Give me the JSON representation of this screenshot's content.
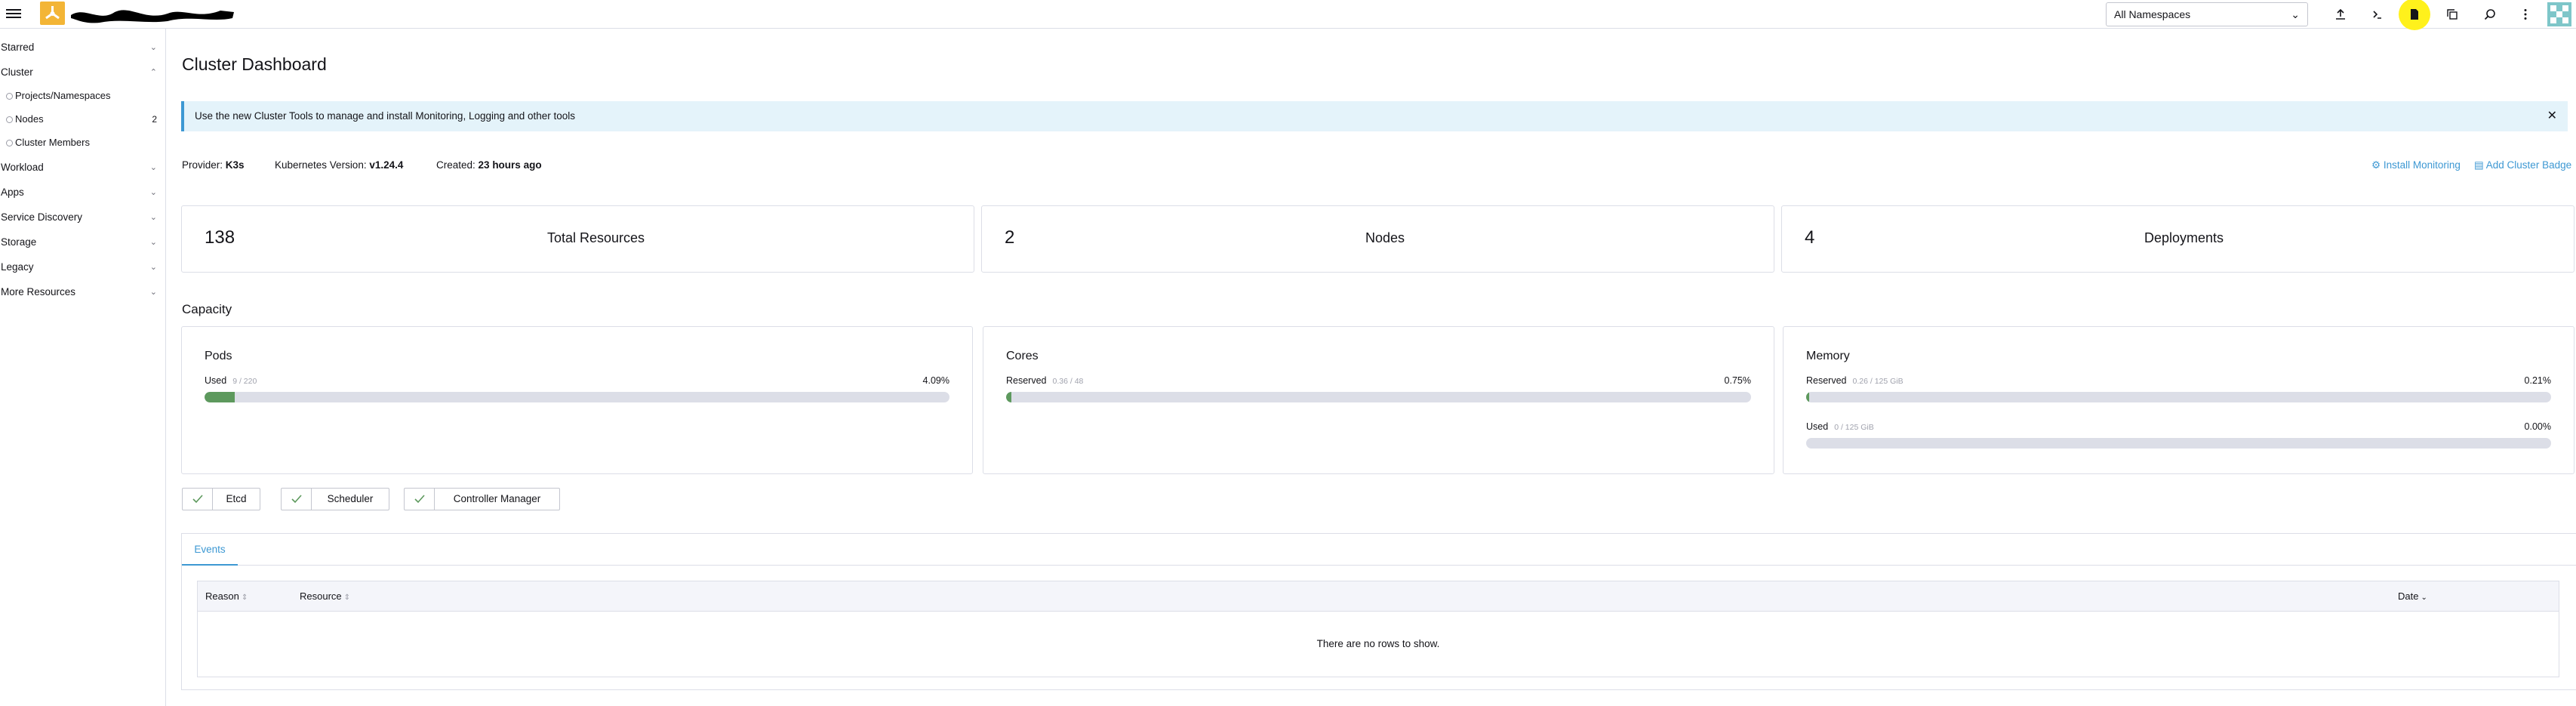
{
  "header": {
    "namespace_select": "All Namespaces",
    "icons": [
      "upload-icon",
      "terminal-icon",
      "file-icon",
      "copy-icon",
      "search-icon",
      "more-vert-icon"
    ]
  },
  "sidebar": {
    "groups": [
      {
        "label": "Starred"
      },
      {
        "label": "Cluster"
      },
      {
        "label": "Workload"
      },
      {
        "label": "Apps"
      },
      {
        "label": "Service Discovery"
      },
      {
        "label": "Storage"
      },
      {
        "label": "Legacy"
      },
      {
        "label": "More Resources"
      }
    ],
    "cluster_items": [
      {
        "label": "Projects/Namespaces",
        "count": ""
      },
      {
        "label": "Nodes",
        "count": "2"
      },
      {
        "label": "Cluster Members",
        "count": ""
      }
    ]
  },
  "main": {
    "title": "Cluster Dashboard",
    "banner": "Use the new Cluster Tools to manage and install Monitoring, Logging and other tools",
    "meta": {
      "provider_label": "Provider:",
      "provider_value": "K3s",
      "k8s_label": "Kubernetes Version:",
      "k8s_value": "v1.24.4",
      "created_label": "Created:",
      "created_value": "23 hours ago"
    },
    "links": {
      "install_monitoring": "Install Monitoring",
      "add_cluster_badge": "Add Cluster Badge"
    },
    "stats": [
      {
        "value": "138",
        "label": "Total Resources"
      },
      {
        "value": "2",
        "label": "Nodes"
      },
      {
        "value": "4",
        "label": "Deployments"
      }
    ],
    "capacity_title": "Capacity",
    "capacity": {
      "pods": {
        "title": "Pods",
        "row_label": "Used",
        "row_sub": "9 / 220",
        "pct": "4.09%",
        "fraction": 0.0409
      },
      "cores": {
        "title": "Cores",
        "row_label": "Reserved",
        "row_sub": "0.36 / 48",
        "pct": "0.75%",
        "fraction": 0.0075
      },
      "memory": {
        "title": "Memory",
        "reserved_label": "Reserved",
        "reserved_sub": "0.26 / 125 GiB",
        "reserved_pct": "0.21%",
        "reserved_fraction": 0.0021,
        "used_label": "Used",
        "used_sub": "0 / 125 GiB",
        "used_pct": "0.00%",
        "used_fraction": 0.0
      }
    },
    "components": [
      "Etcd",
      "Scheduler",
      "Controller Manager"
    ],
    "events": {
      "tab": "Events",
      "columns": [
        "Reason",
        "Resource",
        "Date"
      ],
      "empty": "There are no rows to show."
    }
  },
  "colors": {
    "accent": "#3d98d3",
    "highlight": "#fff11c",
    "bar_fill": "#5d995d",
    "logo": "#f3b536"
  }
}
